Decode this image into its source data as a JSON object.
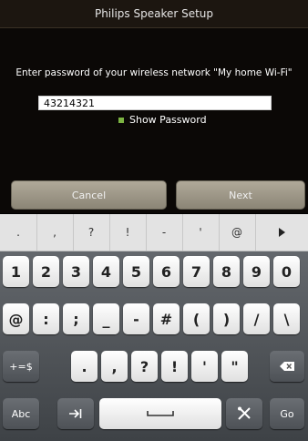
{
  "title": "Philips Speaker Setup",
  "prompt": "Enter password of your wireless network \"My home Wi-Fi\"",
  "password_value": "43214321",
  "show_password_label": "Show Password",
  "buttons": {
    "cancel": "Cancel",
    "next": "Next"
  },
  "suggestions": [
    ".",
    ",",
    "?",
    "!",
    "-",
    "'",
    "@"
  ],
  "keyboard": {
    "row1": [
      "1",
      "2",
      "3",
      "4",
      "5",
      "6",
      "7",
      "8",
      "9",
      "0"
    ],
    "row2": [
      "@",
      ":",
      ";",
      "_",
      "-",
      "#",
      "(",
      ")",
      "/",
      "\\"
    ],
    "row3": [
      ".",
      ",",
      "?",
      "!",
      "'",
      "\""
    ],
    "shift_label": "+=$",
    "abc_label": "Abc",
    "go_label": "Go"
  },
  "colors": {
    "checkbox": "#7cb342",
    "button": "#a39d8f",
    "keyboard_bg": "#54585d"
  }
}
